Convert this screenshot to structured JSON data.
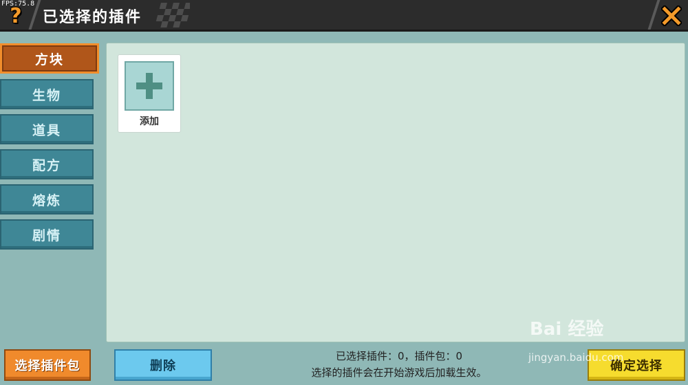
{
  "fps": "FPS:75.8",
  "header": {
    "title": "已选择的插件",
    "help_icon": "question-icon",
    "close_icon": "close-icon",
    "accent": "#f39a2a"
  },
  "sidebar": {
    "items": [
      {
        "label": "方块",
        "active": true
      },
      {
        "label": "生物",
        "active": false
      },
      {
        "label": "道具",
        "active": false
      },
      {
        "label": "配方",
        "active": false
      },
      {
        "label": "熔炼",
        "active": false
      },
      {
        "label": "剧情",
        "active": false
      }
    ]
  },
  "main": {
    "add_card": {
      "label": "添加",
      "icon": "plus-icon"
    }
  },
  "footer": {
    "pack_button": "选择插件包",
    "delete_button": "删除",
    "status_line1": "已选择插件：0，插件包：0",
    "status_line2": "选择的插件会在开始游戏后加载生效。",
    "confirm_button": "确定选择"
  },
  "watermark": {
    "brand": "Bai 经验",
    "url": "jingyan.baidu.com"
  },
  "colors": {
    "title_bar": "#2c2c2c",
    "sidebar_item": "#3f8796",
    "sidebar_active": "#b0561a",
    "panel": "#d2e6dc",
    "pack_button": "#f08a2c",
    "delete_button": "#6cc9ee",
    "confirm_button": "#f6dc2e"
  }
}
